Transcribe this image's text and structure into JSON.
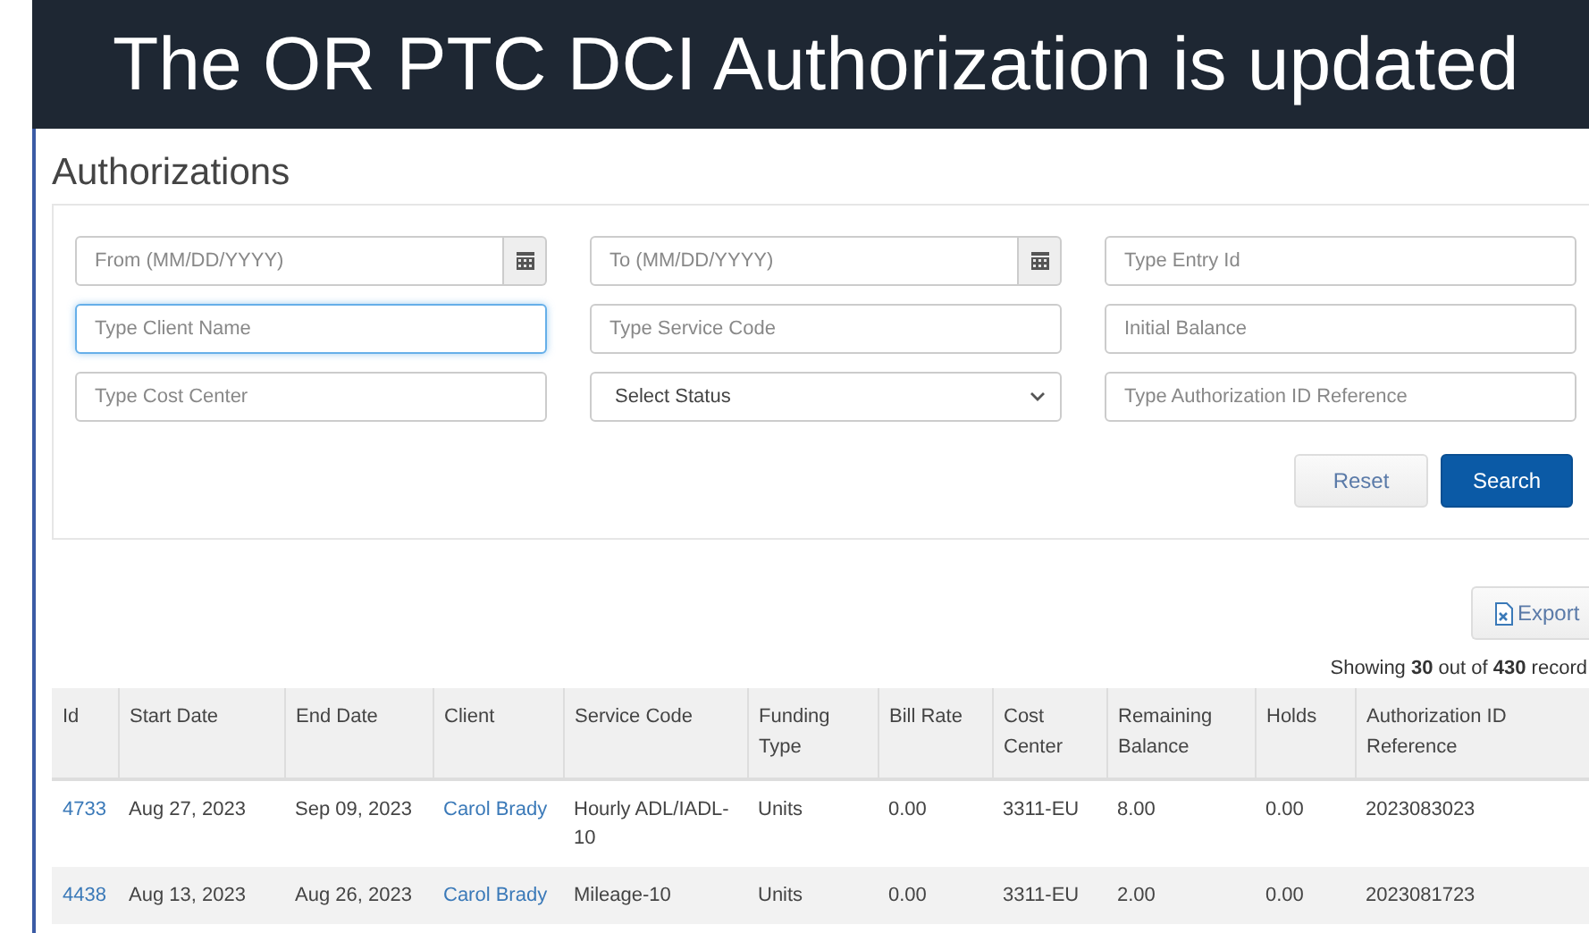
{
  "banner": {
    "title": "The OR PTC DCI Authorization is updated"
  },
  "page": {
    "title": "Authorizations"
  },
  "filters": [
    {
      "kind": "date",
      "placeholder": "From (MM/DD/YYYY)",
      "focused": false
    },
    {
      "kind": "date",
      "placeholder": "To (MM/DD/YYYY)",
      "focused": false
    },
    {
      "kind": "text",
      "placeholder": "Type Entry Id",
      "focused": false
    },
    {
      "kind": "text",
      "placeholder": "Type Client Name",
      "focused": true
    },
    {
      "kind": "text",
      "placeholder": "Type Service Code",
      "focused": false
    },
    {
      "kind": "text",
      "placeholder": "Initial Balance",
      "focused": false
    },
    {
      "kind": "text",
      "placeholder": "Type Cost Center",
      "focused": false
    },
    {
      "kind": "select",
      "value": "Select Status",
      "focused": false
    },
    {
      "kind": "text",
      "placeholder": "Type Authorization ID Reference",
      "focused": false
    }
  ],
  "buttons": [
    {
      "label": "Reset",
      "kind": "secondary"
    },
    {
      "label": "Search",
      "kind": "primary"
    }
  ],
  "export_button": {
    "label": "Export"
  },
  "record_count": "Showing **30** out of **430** record",
  "table": {
    "columns": [
      {
        "label": "Id",
        "kind": "link"
      },
      {
        "label": "Start Date",
        "kind": "text"
      },
      {
        "label": "End Date",
        "kind": "text"
      },
      {
        "label": "Client",
        "kind": "link"
      },
      {
        "label": "Service Code",
        "kind": "text"
      },
      {
        "label": "Funding Type",
        "kind": "text"
      },
      {
        "label": "Bill Rate",
        "kind": "text"
      },
      {
        "label": "Cost Center",
        "kind": "text"
      },
      {
        "label": "Remaining Balance",
        "kind": "text"
      },
      {
        "label": "Holds",
        "kind": "text"
      },
      {
        "label": "Authorization ID Reference",
        "kind": "text"
      }
    ],
    "rows": [
      [
        "4733",
        "Aug 27, 2023",
        "Sep 09, 2023",
        "Carol Brady",
        "Hourly ADL/IADL-10",
        "Units",
        "0.00",
        "3311-EU",
        "8.00",
        "0.00",
        "2023083023"
      ],
      [
        "4438",
        "Aug 13, 2023",
        "Aug 26, 2023",
        "Carol Brady",
        "Mileage-10",
        "Units",
        "0.00",
        "3311-EU",
        "2.00",
        "0.00",
        "2023081723"
      ]
    ]
  }
}
